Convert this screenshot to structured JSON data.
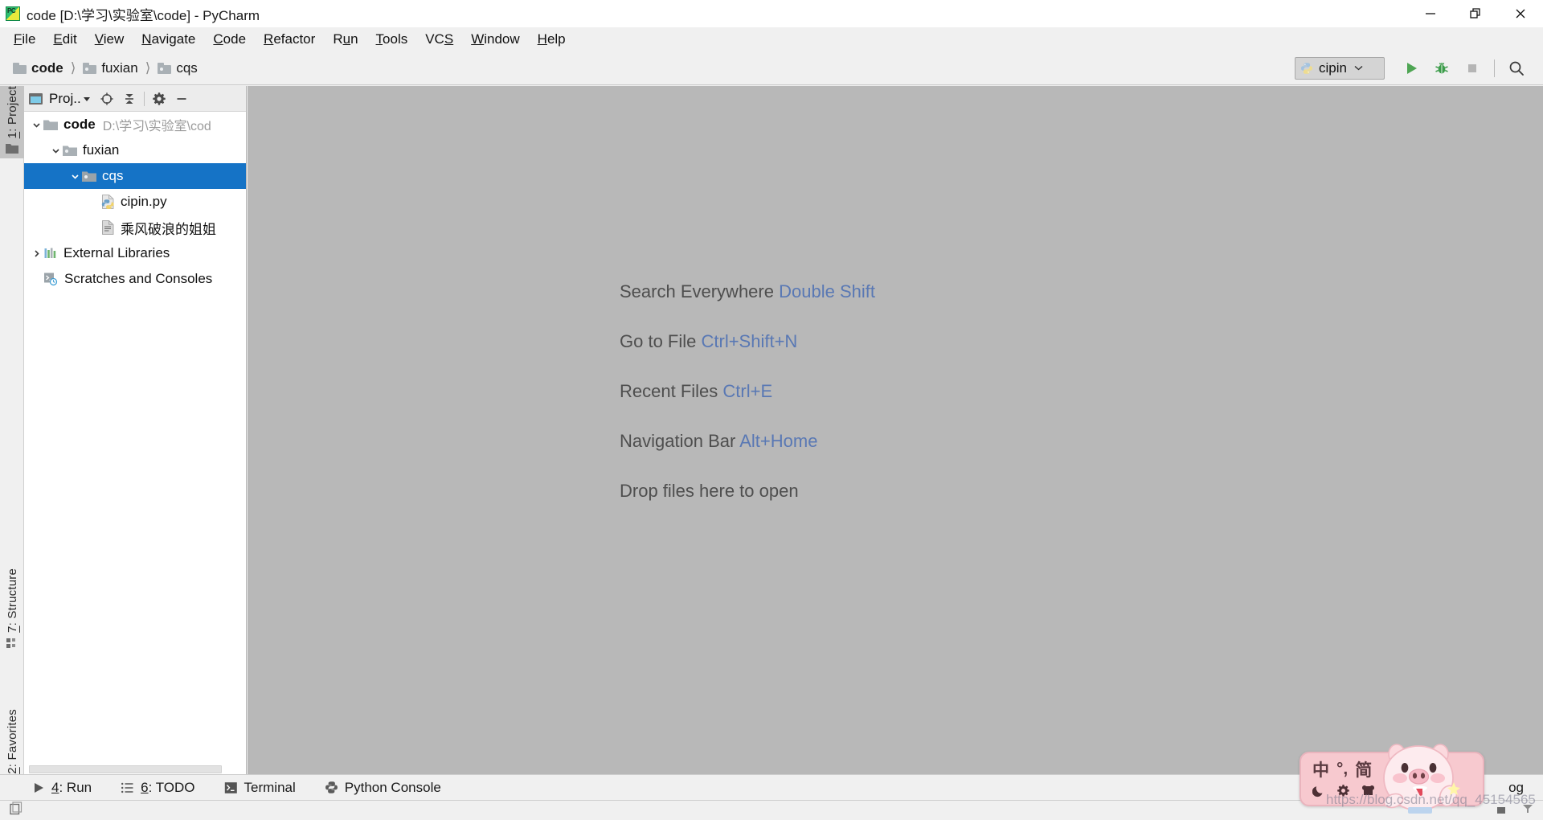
{
  "window": {
    "title": "code [D:\\学习\\实验室\\code] - PyCharm",
    "app_icon": "pycharm-icon",
    "controls": {
      "minimize": "minimize-icon",
      "restore": "restore-icon",
      "close": "close-icon"
    }
  },
  "menubar": {
    "items": [
      {
        "label": "File",
        "mnemonic": "F"
      },
      {
        "label": "Edit",
        "mnemonic": "E"
      },
      {
        "label": "View",
        "mnemonic": "V"
      },
      {
        "label": "Navigate",
        "mnemonic": "N"
      },
      {
        "label": "Code",
        "mnemonic": "C"
      },
      {
        "label": "Refactor",
        "mnemonic": "R"
      },
      {
        "label": "Run",
        "mnemonic": "u"
      },
      {
        "label": "Tools",
        "mnemonic": "T"
      },
      {
        "label": "VCS",
        "mnemonic": "S"
      },
      {
        "label": "Window",
        "mnemonic": "W"
      },
      {
        "label": "Help",
        "mnemonic": "H"
      }
    ]
  },
  "navbar": {
    "breadcrumbs": [
      {
        "label": "code",
        "icon": "folder-icon",
        "bold": true
      },
      {
        "label": "fuxian",
        "icon": "folder-icon",
        "bold": false
      },
      {
        "label": "cqs",
        "icon": "folder-icon",
        "bold": false
      }
    ],
    "separator": "〉",
    "run_config": {
      "name": "cipin",
      "icon": "python-icon",
      "dropdown": "chevron-down-icon"
    },
    "buttons": [
      {
        "name": "run-button",
        "icon": "play-icon",
        "color": "#59a869"
      },
      {
        "name": "debug-button",
        "icon": "bug-icon",
        "color": "#3c9c4a"
      },
      {
        "name": "stop-button",
        "icon": "stop-icon",
        "color": "#b0b0b0"
      },
      {
        "name": "search-button",
        "icon": "search-icon",
        "color": "#4a4a4a"
      }
    ]
  },
  "left_strip": {
    "tabs": [
      {
        "label": "1: Project",
        "mnemonic": "1",
        "icon": "folder-icon",
        "active": true
      },
      {
        "label": "7: Structure",
        "mnemonic": "7",
        "icon": "structure-icon",
        "active": false
      },
      {
        "label": "2: Favorites",
        "mnemonic": "2",
        "icon": "star-icon",
        "active": false
      }
    ]
  },
  "project_panel": {
    "header": {
      "title": "Proj..",
      "window_icon": "project-window-icon",
      "dropdown_icon": "chevron-down-icon",
      "locate_icon": "target-icon",
      "collapse_icon": "collapse-all-icon",
      "settings_icon": "gear-icon",
      "hide_icon": "minimize-icon"
    },
    "tree": [
      {
        "label": "code",
        "sub": "D:\\学习\\实验室\\cod",
        "icon": "folder-icon",
        "indent": 0,
        "twisty": "expanded",
        "bold": true,
        "selected": false
      },
      {
        "label": "fuxian",
        "sub": "",
        "icon": "folder-icon",
        "indent": 1,
        "twisty": "expanded",
        "bold": false,
        "selected": false
      },
      {
        "label": "cqs",
        "sub": "",
        "icon": "folder-icon",
        "indent": 2,
        "twisty": "expanded",
        "bold": false,
        "selected": true
      },
      {
        "label": "cipin.py",
        "sub": "",
        "icon": "python-file-icon",
        "indent": 3,
        "twisty": "none",
        "bold": false,
        "selected": false
      },
      {
        "label": "乘风破浪的姐姐",
        "sub": "",
        "icon": "text-file-icon",
        "indent": 3,
        "twisty": "none",
        "bold": false,
        "selected": false
      },
      {
        "label": "External Libraries",
        "sub": "",
        "icon": "libraries-icon",
        "indent": 0,
        "twisty": "collapsed",
        "bold": false,
        "selected": false
      },
      {
        "label": "Scratches and Consoles",
        "sub": "",
        "icon": "scratches-icon",
        "indent": 0,
        "twisty": "none",
        "bold": false,
        "selected": false
      }
    ]
  },
  "editor": {
    "hints": [
      {
        "action": "Search Everywhere",
        "shortcut": "Double Shift"
      },
      {
        "action": "Go to File",
        "shortcut": "Ctrl+Shift+N"
      },
      {
        "action": "Recent Files",
        "shortcut": "Ctrl+E"
      },
      {
        "action": "Navigation Bar",
        "shortcut": "Alt+Home"
      },
      {
        "action": "Drop files here to open",
        "shortcut": ""
      }
    ]
  },
  "bottom_bar": {
    "buttons": [
      {
        "label": "4: Run",
        "mnemonic": "4",
        "icon": "play-icon"
      },
      {
        "label": "6: TODO",
        "mnemonic": "6",
        "icon": "list-icon"
      },
      {
        "label": "Terminal",
        "mnemonic": "",
        "icon": "terminal-icon"
      },
      {
        "label": "Python Console",
        "mnemonic": "",
        "icon": "python-icon"
      }
    ],
    "event_log": "og"
  },
  "status_bar": {
    "icon": "layout-icon",
    "text": ""
  },
  "ime_widget": {
    "mode": "中",
    "punctuation": "°,",
    "script": "简",
    "moon_icon": "moon-icon",
    "gear_icon": "gear-icon",
    "skin_icon": "skin-icon",
    "mascot": "pig-mascot",
    "watermark": "https://blog.csdn.net/qq_45154565"
  },
  "colors": {
    "accent_selection": "#1573c6",
    "editor_bg": "#b8b8b8",
    "chrome_bg": "#f0f0f0",
    "hint_key": "#5978b4",
    "run_green": "#59a869"
  }
}
